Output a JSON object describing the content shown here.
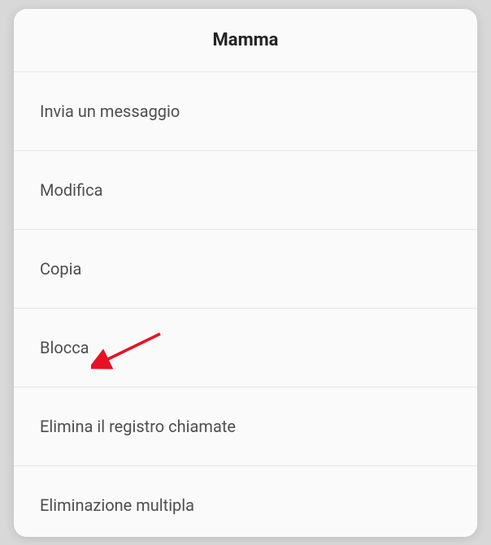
{
  "dialog": {
    "title": "Mamma",
    "items": [
      {
        "label": "Invia un messaggio"
      },
      {
        "label": "Modifica"
      },
      {
        "label": "Copia"
      },
      {
        "label": "Blocca"
      },
      {
        "label": "Elimina il registro chiamate"
      },
      {
        "label": "Eliminazione multipla"
      }
    ]
  }
}
